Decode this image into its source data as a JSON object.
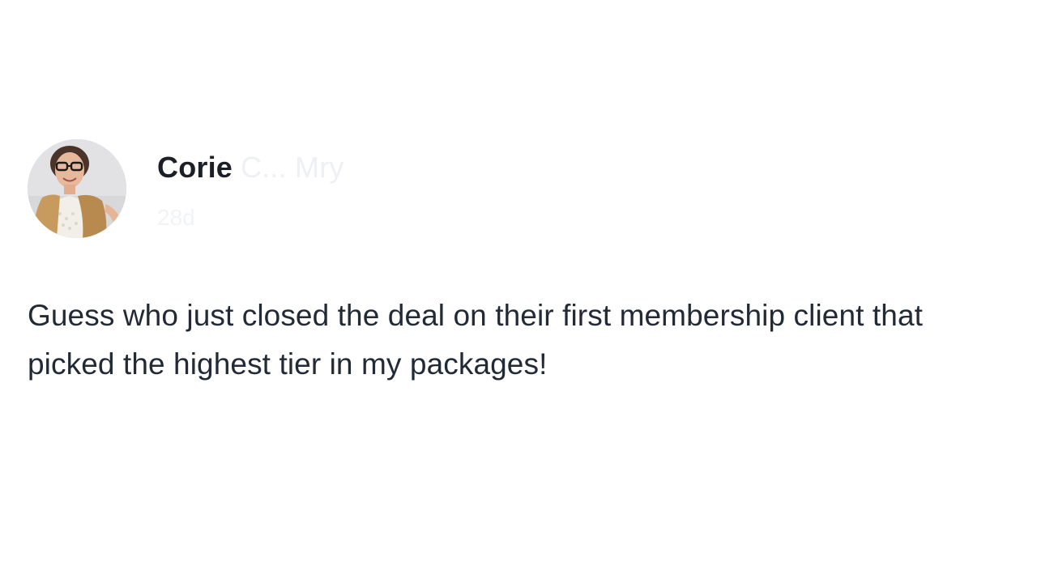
{
  "post": {
    "author": {
      "name": "Corie",
      "name_faded": "C... Mry",
      "avatar": "profile-photo"
    },
    "meta": {
      "time_ago": "28d"
    },
    "body": "Guess who just closed the deal on their first membership client that picked the highest tier in my packages!"
  }
}
